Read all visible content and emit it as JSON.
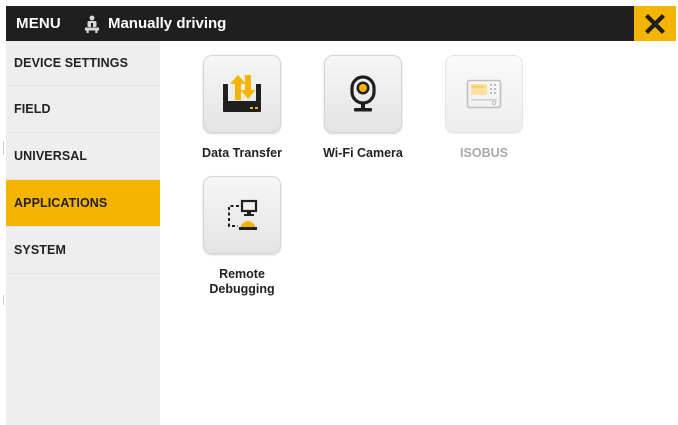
{
  "header": {
    "menu_label": "MENU",
    "status_text": "Manually driving",
    "close_label": "✕"
  },
  "sidebar": {
    "items": [
      {
        "label": "DEVICE SETTINGS",
        "active": false
      },
      {
        "label": "FIELD",
        "active": false
      },
      {
        "label": "UNIVERSAL",
        "active": false
      },
      {
        "label": "APPLICATIONS",
        "active": true
      },
      {
        "label": "SYSTEM",
        "active": false
      }
    ]
  },
  "apps": [
    {
      "label": "Data Transfer",
      "icon": "data-transfer-icon",
      "enabled": true
    },
    {
      "label": "Wi-Fi Camera",
      "icon": "camera-icon",
      "enabled": true
    },
    {
      "label": "ISOBUS",
      "icon": "isobus-terminal-icon",
      "enabled": false
    },
    {
      "label": "Remote Debugging",
      "label_lines": [
        "Remote",
        "Debugging"
      ],
      "icon": "remote-debugging-icon",
      "enabled": true
    }
  ],
  "colors": {
    "accent": "#f5b400",
    "topbar": "#1f1f1f",
    "sidebar": "#eeeeee",
    "disabled_text": "#a8a8a8"
  }
}
